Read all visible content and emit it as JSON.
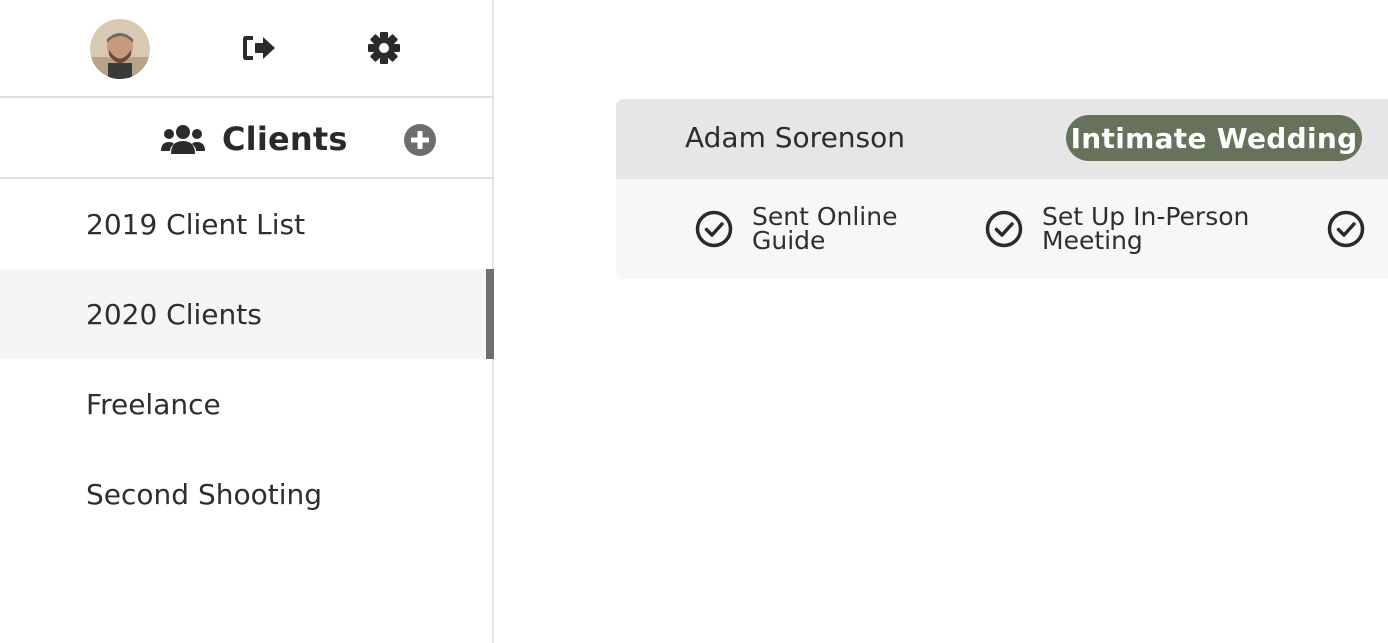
{
  "sidebar": {
    "header": {
      "title": "Clients"
    },
    "items": [
      {
        "label": "2019 Client List",
        "active": false
      },
      {
        "label": "2020 Clients",
        "active": true
      },
      {
        "label": "Freelance",
        "active": false
      },
      {
        "label": "Second Shooting",
        "active": false
      }
    ]
  },
  "icons": {
    "avatar": "user-avatar",
    "logout": "sign-out-icon",
    "settings": "gear-icon",
    "clients": "users-icon",
    "add": "plus-circle-icon",
    "task": "check-circle-icon"
  },
  "main": {
    "client_card": {
      "name": "Adam Sorenson",
      "tag": "Intimate Wedding",
      "tasks": [
        {
          "label": "Sent Online\nGuide",
          "done": true
        },
        {
          "label": "Set Up In-Person\nMeeting",
          "done": true
        },
        {
          "label": "",
          "done": true
        }
      ]
    }
  },
  "colors": {
    "badge": "#66735a",
    "active_indicator": "#6f6f6f",
    "header_bg": "#e6e6e6"
  }
}
